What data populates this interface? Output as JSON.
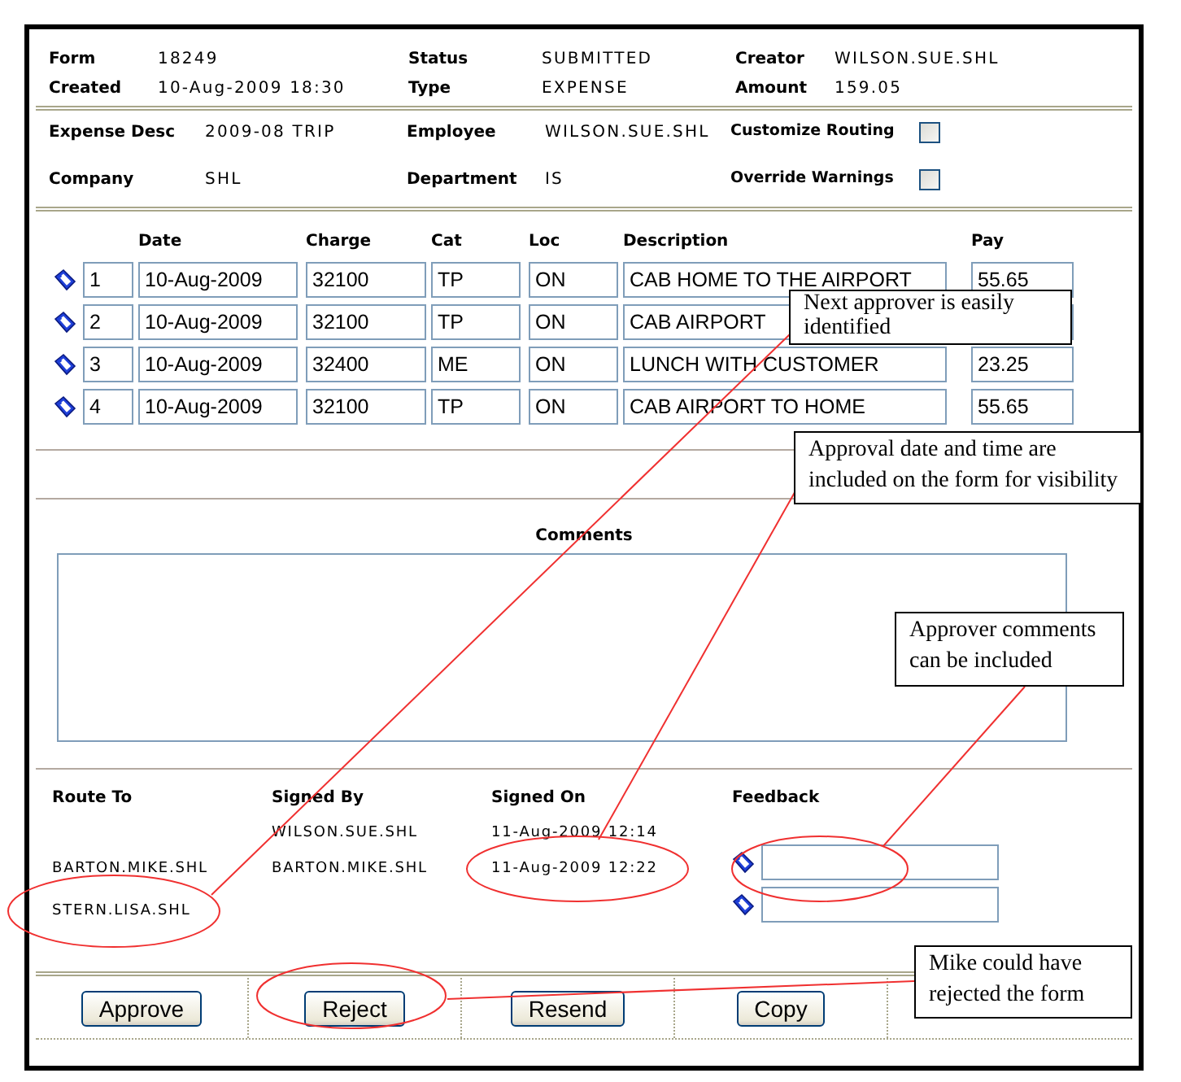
{
  "header": [
    {
      "label": "Form",
      "value": "18249"
    },
    {
      "label": "Status",
      "value": "SUBMITTED"
    },
    {
      "label": "Creator",
      "value": "WILSON.SUE.SHL"
    },
    {
      "label": "Created",
      "value": "10-Aug-2009 18:30"
    },
    {
      "label": "Type",
      "value": "EXPENSE"
    },
    {
      "label": "Amount",
      "value": "159.05"
    }
  ],
  "details": [
    {
      "kind": "text",
      "label": "Expense Desc",
      "value": "2009-08 TRIP"
    },
    {
      "kind": "text",
      "label": "Employee",
      "value": "WILSON.SUE.SHL"
    },
    {
      "kind": "checkbox",
      "label": "Customize Routing",
      "checked": false
    },
    {
      "kind": "text",
      "label": "Company",
      "value": "SHL"
    },
    {
      "kind": "text",
      "label": "Department",
      "value": "IS"
    },
    {
      "kind": "checkbox",
      "label": "Override Warnings",
      "checked": false
    }
  ],
  "lines": {
    "columns": [
      "Date",
      "Charge",
      "Cat",
      "Loc",
      "Description",
      "Pay"
    ],
    "rows": [
      {
        "line": "1",
        "date": "10-Aug-2009",
        "charge": "32100",
        "cat": "TP",
        "loc": "ON",
        "description": "CAB HOME TO THE AIRPORT",
        "pay": "55.65"
      },
      {
        "line": "2",
        "date": "10-Aug-2009",
        "charge": "32100",
        "cat": "TP",
        "loc": "ON",
        "description": "CAB AIRPORT"
      },
      {
        "line": "3",
        "date": "10-Aug-2009",
        "charge": "32400",
        "cat": "ME",
        "loc": "ON",
        "description": "LUNCH WITH CUSTOMER",
        "pay": "23.25"
      },
      {
        "line": "4",
        "date": "10-Aug-2009",
        "charge": "32100",
        "cat": "TP",
        "loc": "ON",
        "description": "CAB AIRPORT TO HOME",
        "pay": "55.65"
      }
    ]
  },
  "comments": {
    "label": "Comments"
  },
  "routing": {
    "columns": [
      "Route To",
      "Signed By",
      "Signed On",
      "Feedback"
    ],
    "rows": [
      {
        "signed_by": "WILSON.SUE.SHL",
        "signed_on": "11-Aug-2009 12:14",
        "feedback_field": false
      },
      {
        "route_to": "BARTON.MIKE.SHL",
        "signed_by": "BARTON.MIKE.SHL",
        "signed_on": "11-Aug-2009 12:22",
        "feedback_field": true
      },
      {
        "route_to": "STERN.LISA.SHL",
        "feedback_field": true
      }
    ]
  },
  "buttons": [
    "Approve",
    "Reject",
    "Resend",
    "Copy"
  ],
  "callouts": [
    {
      "text": "Next approver is easily identified"
    },
    {
      "text": "Approval date and time are included on the form for visibility"
    },
    {
      "text": "Approver comments can be included"
    },
    {
      "text": "Mike could have rejected the form"
    }
  ]
}
